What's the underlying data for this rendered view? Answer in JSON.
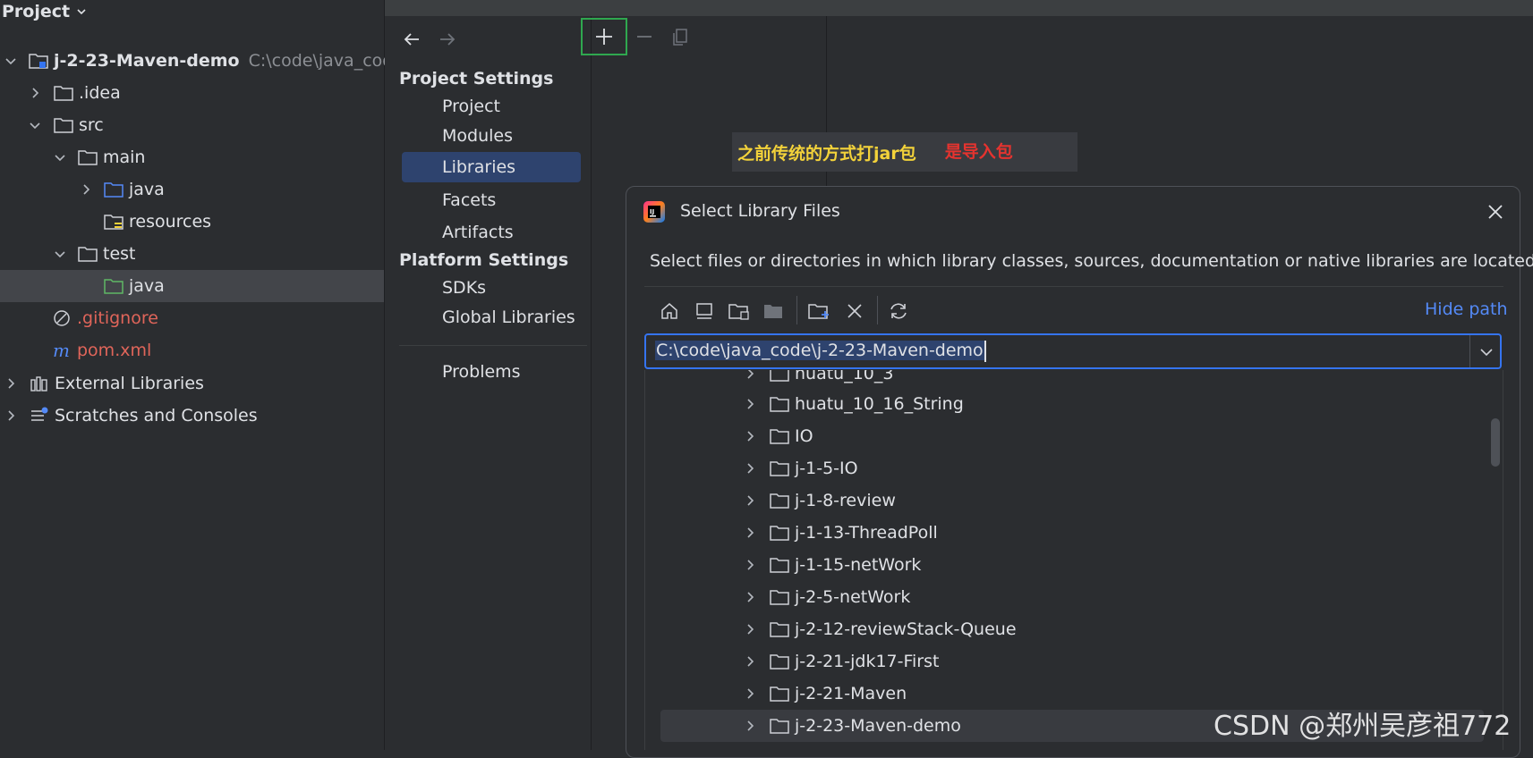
{
  "project_panel": {
    "title": "Project",
    "tree": [
      {
        "label": "j-2-23-Maven-demo",
        "path": "C:\\code\\java_cod",
        "icon": "module-folder-icon",
        "expanded": true
      },
      {
        "label": ".idea",
        "icon": "folder-icon",
        "expanded": false
      },
      {
        "label": "src",
        "icon": "folder-icon",
        "expanded": true
      },
      {
        "label": "main",
        "icon": "folder-icon",
        "expanded": true
      },
      {
        "label": "java",
        "icon": "source-folder-icon",
        "expanded": false
      },
      {
        "label": "resources",
        "icon": "resources-folder-icon"
      },
      {
        "label": "test",
        "icon": "folder-icon",
        "expanded": true
      },
      {
        "label": "java",
        "icon": "test-folder-icon",
        "selected": true
      },
      {
        "label": ".gitignore",
        "icon": "ignore-icon"
      },
      {
        "label": "pom.xml",
        "icon": "maven-icon"
      },
      {
        "label": "External Libraries",
        "icon": "libraries-icon",
        "expanded": false
      },
      {
        "label": "Scratches and Consoles",
        "icon": "scratches-icon",
        "expanded": false
      }
    ]
  },
  "settings": {
    "project_settings_title": "Project Settings",
    "project_items": [
      "Project",
      "Modules",
      "Libraries",
      "Facets",
      "Artifacts"
    ],
    "active_item": "Libraries",
    "platform_settings_title": "Platform Settings",
    "platform_items": [
      "SDKs",
      "Global Libraries"
    ],
    "problems_label": "Problems"
  },
  "annotation": {
    "yellow_text": "之前传统的方式打jar包",
    "red_text": "是导入包"
  },
  "dialog": {
    "title": "Select Library Files",
    "description": "Select files or directories in which library classes, sources, documentation or native libraries are located",
    "hide_path": "Hide path",
    "path_value": "C:\\code\\java_code\\j-2-23-Maven-demo",
    "partial_row": "huatu_10_3",
    "rows": [
      "huatu_10_16_String",
      "IO",
      "j-1-5-IO",
      "j-1-8-review",
      "j-1-13-ThreadPoll",
      "j-1-15-netWork",
      "j-2-5-netWork",
      "j-2-12-reviewStack-Queue",
      "j-2-21-jdk17-First",
      "j-2-21-Maven",
      "j-2-23-Maven-demo"
    ],
    "selected_row": "j-2-23-Maven-demo"
  },
  "watermark": "CSDN @郑州吴彦祖772",
  "colors": {
    "accent": "#3574f0",
    "selection": "#2e436e",
    "highlight_border": "#2fa84f",
    "annotation_yellow": "#f3d23a",
    "annotation_red": "#e5332f"
  }
}
